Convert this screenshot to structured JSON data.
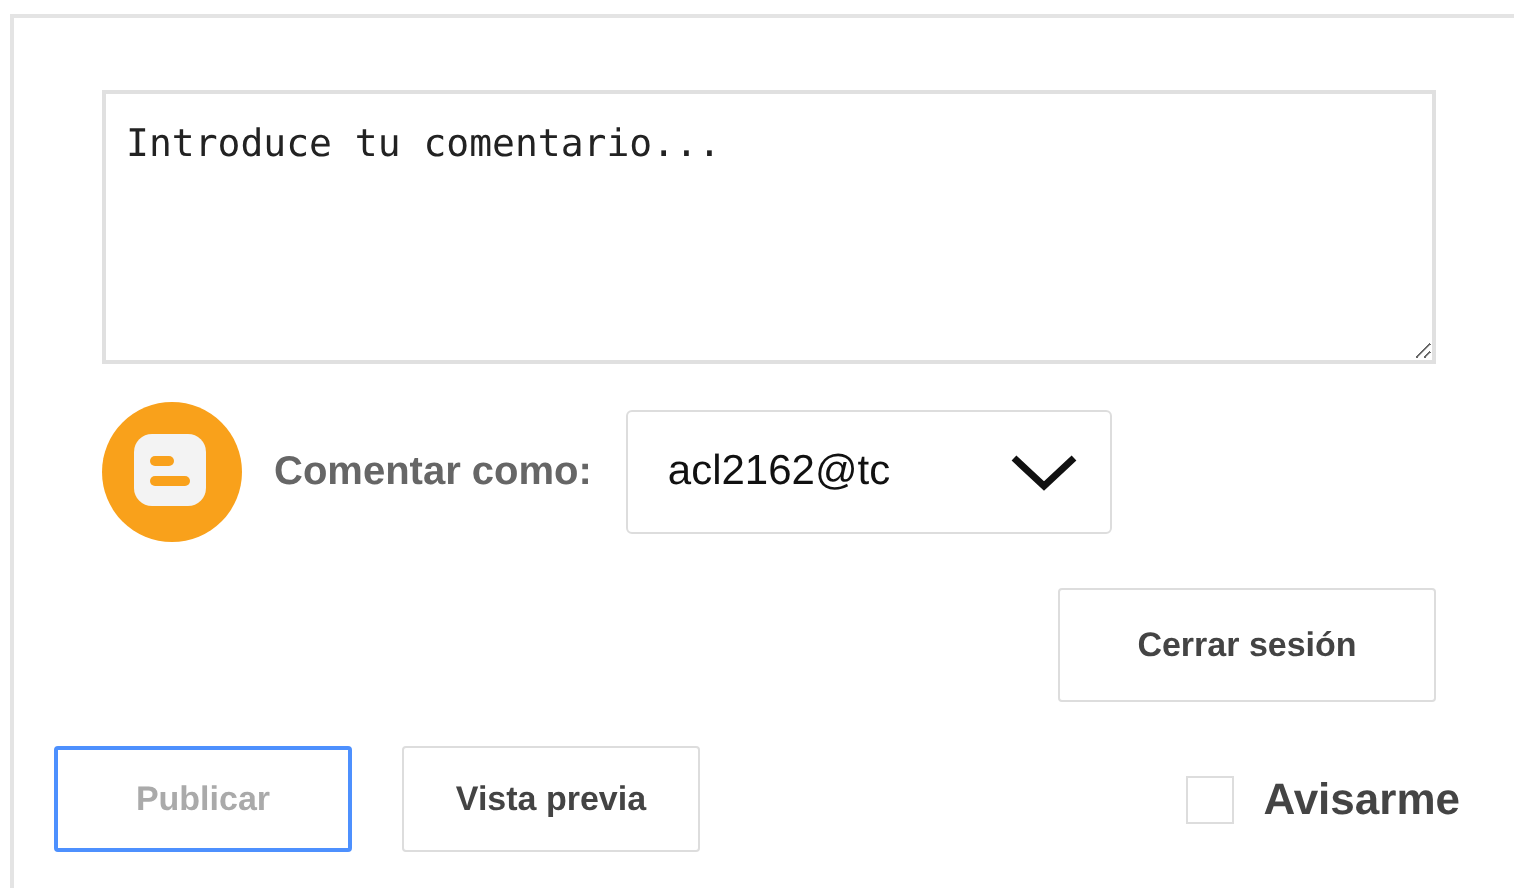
{
  "comment": {
    "placeholder": "Introduce tu comentario..."
  },
  "identity": {
    "label": "Comentar como:",
    "account": "acl2162@tc"
  },
  "sign_out": {
    "label": "Cerrar sesión"
  },
  "buttons": [
    {
      "label": "Publicar",
      "disabled": true,
      "focused": true
    },
    {
      "label": "Vista previa",
      "disabled": false,
      "focused": false
    }
  ],
  "notify": {
    "label": "Avisarme",
    "checked": false
  }
}
